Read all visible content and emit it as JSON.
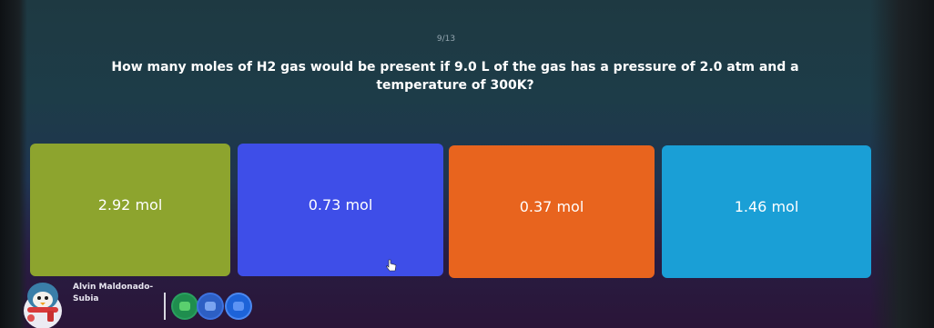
{
  "quiz": {
    "counter": "9/13",
    "question": "How many moles of H2 gas would be present if 9.0 L of the gas has a pressure of 2.0 atm and a temperature of 300K?",
    "options": [
      {
        "label": "2.92 mol",
        "color": "#8da42e"
      },
      {
        "label": "0.73 mol",
        "color": "#3e4ee8"
      },
      {
        "label": "0.37 mol",
        "color": "#e8641e"
      },
      {
        "label": "1.46 mol",
        "color": "#1a9fd6"
      }
    ]
  },
  "player": {
    "name": "Alvin Maldonado-Subia",
    "avatar_icon": "penguin-avatar-icon"
  },
  "powerups": [
    {
      "icon": "powerup-green-icon",
      "color": "#1f8e4e"
    },
    {
      "icon": "powerup-blue-icon",
      "color": "#2d5fc4"
    },
    {
      "icon": "powerup-royal-blue-icon",
      "color": "#1d63d8"
    }
  ]
}
